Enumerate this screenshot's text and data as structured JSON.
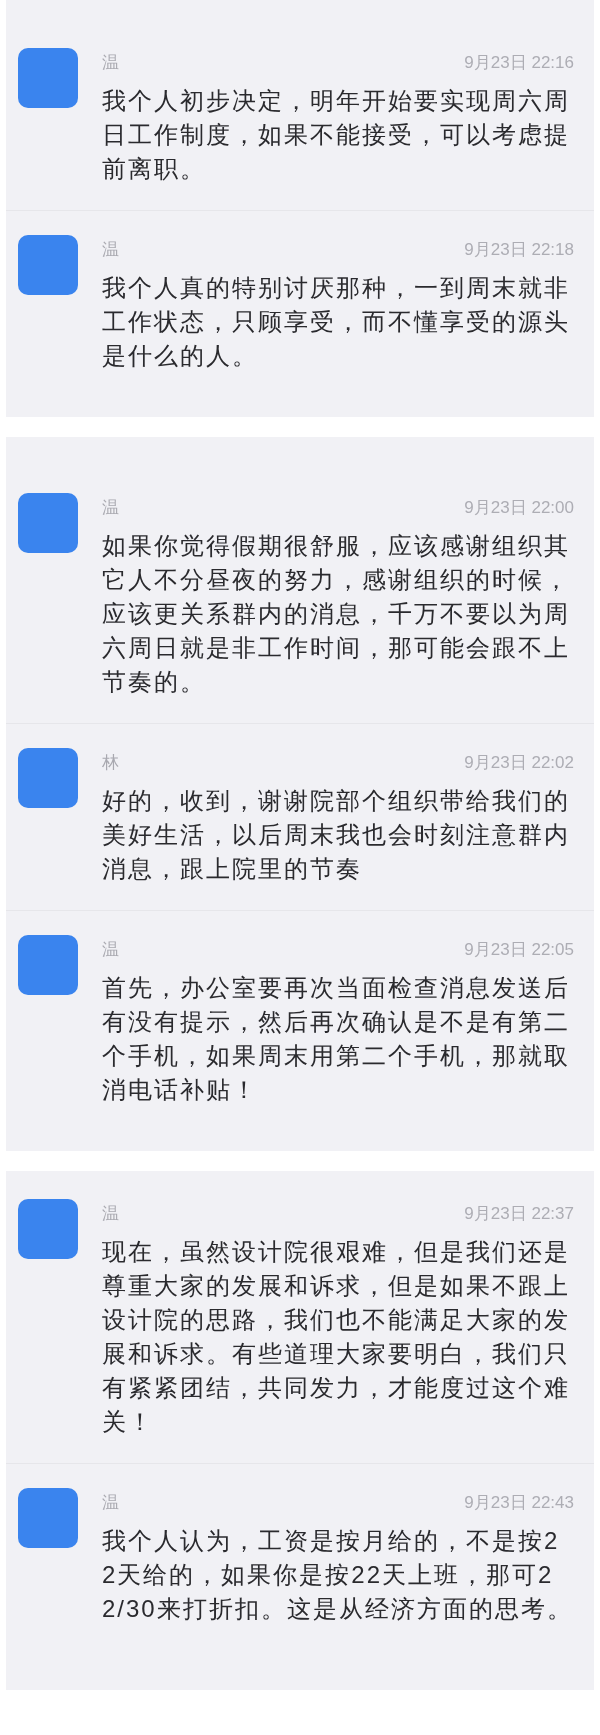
{
  "panels": [
    {
      "messages": [
        {
          "sender": "温",
          "time": "9月23日 22:16",
          "text": "我个人初步决定，明年开始要实现周六周日工作制度，如果不能接受，可以考虑提前离职。"
        },
        {
          "sender": "温",
          "time": "9月23日 22:18",
          "text": "我个人真的特别讨厌那种，一到周末就非工作状态，只顾享受，而不懂享受的源头是什么的人。"
        }
      ]
    },
    {
      "messages": [
        {
          "sender": "温",
          "time": "9月23日 22:00",
          "text": "如果你觉得假期很舒服，应该感谢组织其它人不分昼夜的努力，感谢组织的时候，应该更关系群内的消息，千万不要以为周六周日就是非工作时间，那可能会跟不上节奏的。"
        },
        {
          "sender": "林",
          "time": "9月23日 22:02",
          "text": "好的，收到，谢谢院部个组织带给我们的美好生活，以后周末我也会时刻注意群内消息，跟上院里的节奏"
        },
        {
          "sender": "温",
          "time": "9月23日 22:05",
          "text": "首先，办公室要再次当面检查消息发送后有没有提示，然后再次确认是不是有第二个手机，如果周末用第二个手机，那就取消电话补贴！"
        }
      ]
    },
    {
      "messages": [
        {
          "sender": "温",
          "time": "9月23日 22:37",
          "text": "现在，虽然设计院很艰难，但是我们还是尊重大家的发展和诉求，但是如果不跟上设计院的思路，我们也不能满足大家的发展和诉求。有些道理大家要明白，我们只有紧紧团结，共同发力，才能度过这个难关！"
        },
        {
          "sender": "温",
          "time": "9月23日 22:43",
          "text": "我个人认为，工资是按月给的，不是按22天给的，如果你是按22天上班，那可22/30来打折扣。这是从经济方面的思考。"
        }
      ]
    }
  ]
}
